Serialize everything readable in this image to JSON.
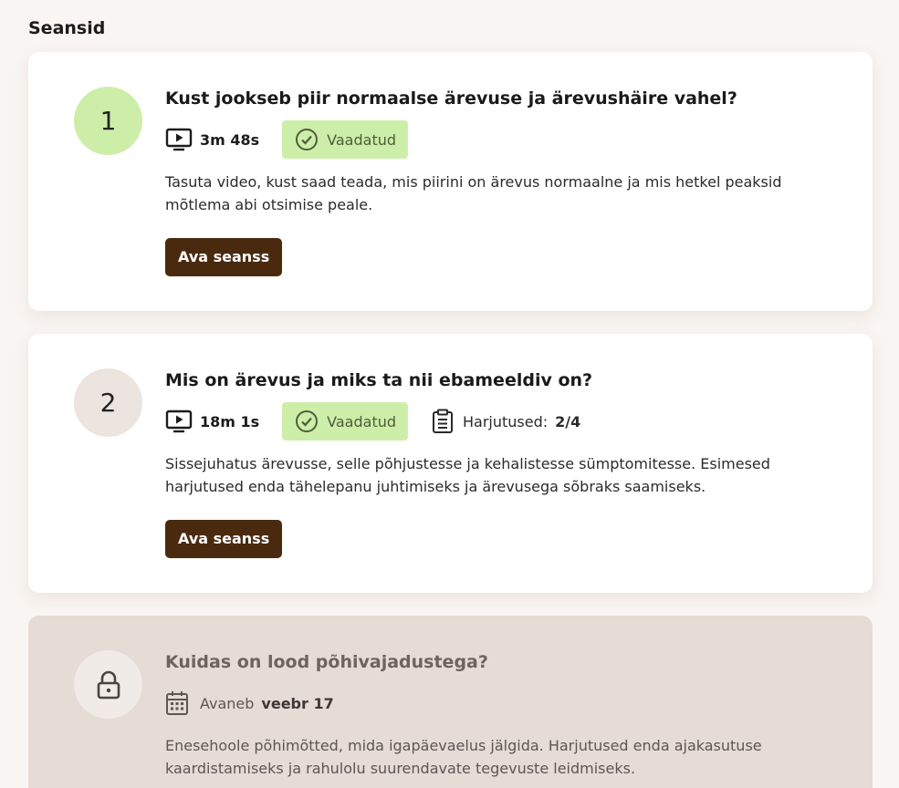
{
  "page": {
    "section_title": "Seansid"
  },
  "sessions": [
    {
      "number": "1",
      "circle_color": "#cdeea8",
      "title": "Kust jookseb piir normaalse ärevuse ja ärevushäire vahel?",
      "duration": "3m 48s",
      "status": "Vaadatud",
      "description": "Tasuta video, kust saad teada, mis piirini on ärevus normaalne ja mis hetkel peaksid mõtlema abi otsimise peale.",
      "button": "Ava seanss"
    },
    {
      "number": "2",
      "circle_color": "#ece4df",
      "title": "Mis on ärevus ja miks ta nii ebameeldiv on?",
      "duration": "18m 1s",
      "status": "Vaadatud",
      "exercises_label": "Harjutused:",
      "exercises_value": "2/4",
      "description": "Sissejuhatus ärevusse, selle põhjustesse ja kehalistesse sümptomitesse. Esimesed harjutused enda tähelepanu juhtimiseks ja ärevusega sõbraks saamiseks.",
      "button": "Ava seanss"
    },
    {
      "icon": "lock-icon",
      "title": "Kuidas on lood põhivajadustega?",
      "opens_label": "Avaneb",
      "opens_date": "veebr 17",
      "description": "Enesehoole põhimõtted, mida igapäevaelus jälgida. Harjutused enda ajakasutuse kaardistamiseks ja rahulolu suurendavate tegevuste leidmiseks."
    }
  ],
  "colors": {
    "accent_green": "#cdeea8",
    "button_brown": "#4a2a0f",
    "locked_bg": "#e6dbd5"
  }
}
